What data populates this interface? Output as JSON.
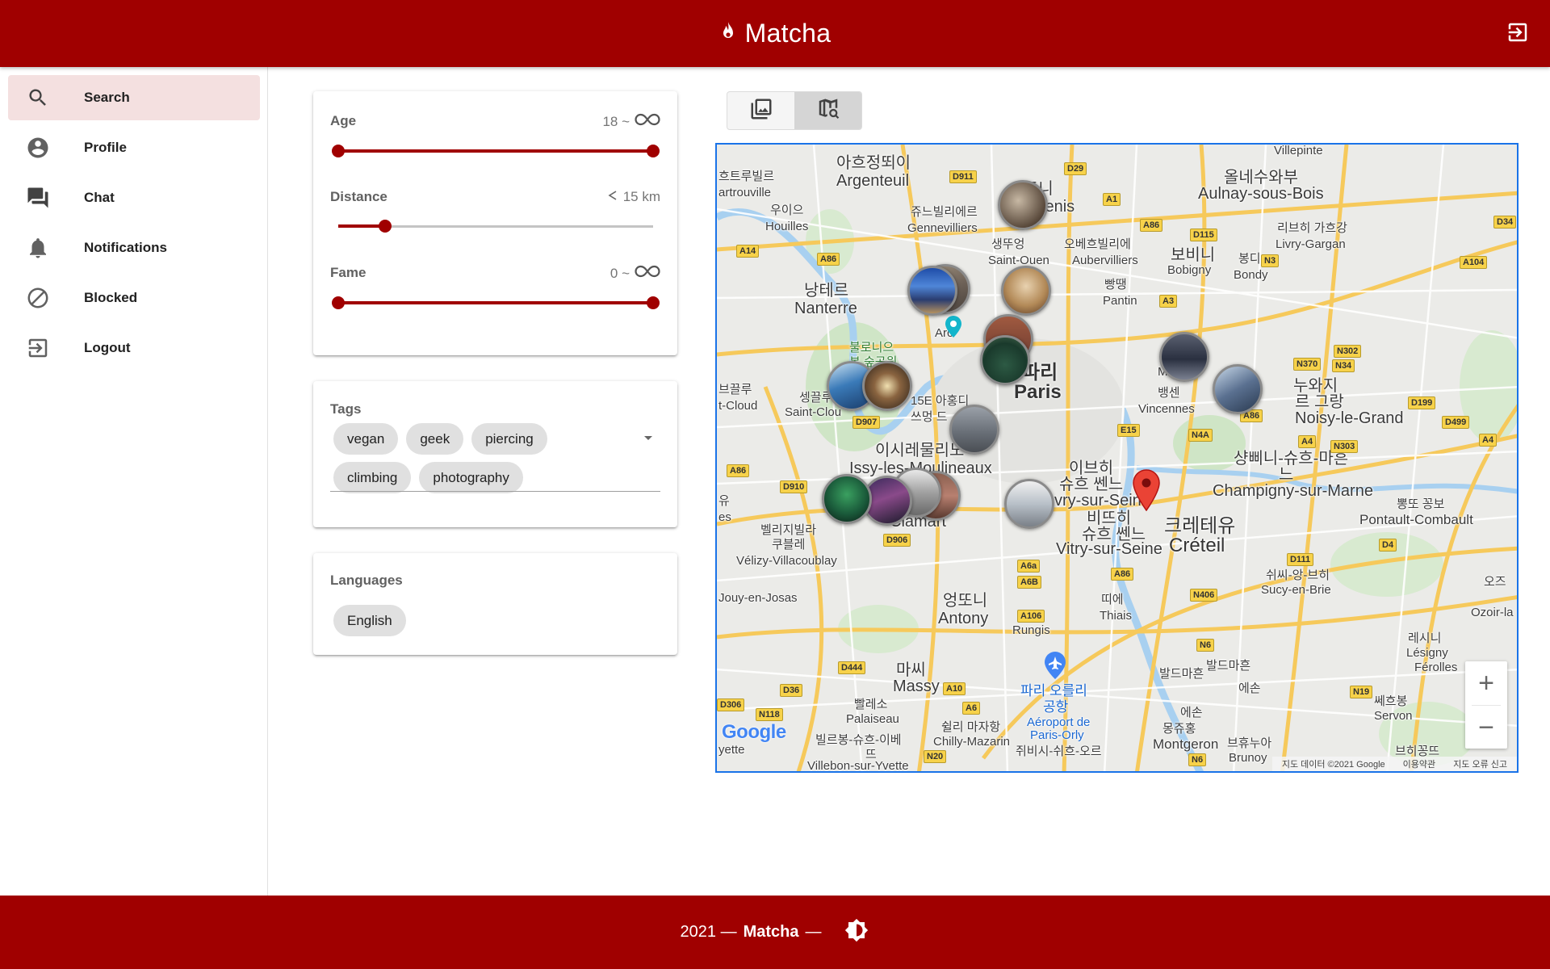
{
  "app": {
    "title": "Matcha",
    "brand_icon": "fire-icon",
    "logout_icon": "logout-icon"
  },
  "sidebar": {
    "items": [
      {
        "label": "Search",
        "icon": "search-icon",
        "active": true
      },
      {
        "label": "Profile",
        "icon": "account-circle-icon"
      },
      {
        "label": "Chat",
        "icon": "forum-icon"
      },
      {
        "label": "Notifications",
        "icon": "bell-icon"
      },
      {
        "label": "Blocked",
        "icon": "block-icon"
      },
      {
        "label": "Logout",
        "icon": "logout-icon"
      }
    ]
  },
  "filters": {
    "age": {
      "label": "Age",
      "value_prefix": "18 ~",
      "value_suffix_icon": "infinity-icon",
      "range": [
        0,
        1
      ]
    },
    "distance": {
      "label": "Distance",
      "value_prefix_icon": "less-than-icon",
      "value": "15 km",
      "level": 0.12
    },
    "fame": {
      "label": "Fame",
      "value_prefix": "0 ~",
      "value_suffix_icon": "infinity-icon",
      "range": [
        0,
        1
      ]
    }
  },
  "tags": {
    "label": "Tags",
    "items": [
      "vegan",
      "geek",
      "piercing",
      "climbing",
      "photography"
    ]
  },
  "languages": {
    "label": "Languages",
    "items": [
      "English"
    ]
  },
  "view_toggle": {
    "options": [
      "gallery-icon",
      "map-search-icon"
    ],
    "active": 1
  },
  "map": {
    "labels": {
      "argenteuil_ko": "아흐정뙤이",
      "argenteuil": "Argenteuil",
      "sartrouville_ko": "흐트루빌르",
      "sartrouville": "artrouville",
      "houilles_ko": "우이으",
      "houilles": "Houilles",
      "gennevilliers_ko": "쥬느빌리에르",
      "gennevilliers": "Gennevilliers",
      "saintdenis_ko": "드니",
      "saintdenis": "Denis",
      "saintouen_ko": "생뚜엉",
      "saintouen": "Saint-Ouen",
      "aubervilliers_ko": "오베흐빌리에",
      "aubervilliers": "Aubervilliers",
      "bobigny_ko": "보비니",
      "bobigny": "Bobigny",
      "bondy_ko": "봉디",
      "bondy": "Bondy",
      "pantin_ko": "빵땡",
      "pantin": "Pantin",
      "aulnay_ko": "올네수와부",
      "aulnay": "Aulnay-sous-Bois",
      "livry_ko": "리브히 가흐강",
      "livry": "Livry-Gargan",
      "villepinte": "Villepinte",
      "nanterre_ko": "낭테르",
      "nanterre": "Nanterre",
      "arc": "Arc",
      "paris_ko": "파리",
      "paris": "Paris",
      "boulogne_ko": "불로니으",
      "boulogne_ko2": "본 숲공원",
      "saintcloud_ko": "셍끌루",
      "saintcloud": "Saint-Clou",
      "bougival_ko": "브끌루",
      "bougival": "t-Cloud",
      "arr15_ko": "15E 아홍디",
      "arr15b_ko": "쓰멍 드 ",
      "arr15c": "15",
      "issy_ko": "이시레물리노",
      "issy": "Issy-les-Moulineaux",
      "montreuil": "Mo",
      "vincennes_ko": "뱅센",
      "vincennes": "Vincennes",
      "noisy_ko": "누와지",
      "noisy_ko2": "르 그랑",
      "noisy": "Noisy-le-Grand",
      "champigny_ko": "샹삐니-슈흐-마흔",
      "champigny_ko2": "느",
      "champigny": "Champigny-sur-Marne",
      "ivry_ko": "이브히",
      "ivry_ko2": "슈흐 쎈느",
      "ivry": "vry-sur-Seine",
      "vitry_ko": "비뜨히",
      "vitry_ko2": "슈흐 쎈느",
      "vitry": "Vitry-sur-Seine",
      "creteil_ko": "크레테유",
      "creteil": "Créteil",
      "pontault_ko": "뽕또 꽁보",
      "pontault": "Pontault-Combault",
      "clamart": "Clamart",
      "velizy_ko": "벨리지빌라",
      "velizy_ko2": "쿠블레",
      "velizy": "Vélizy-Villacoublay",
      "jouy": "Jouy-en-Josas",
      "antony_ko": "엉또니",
      "antony": "Antony",
      "thiais_ko": "띠에",
      "thiais": "Thiais",
      "rungis": "Rungis",
      "sucy_ko": "쉬씨-앙-브히",
      "sucy": "Sucy-en-Brie",
      "ozoir_ko": "오즈",
      "ozoir": "Ozoir-la",
      "lesigny_ko": "레시니",
      "lesigny": "Lésigny",
      "ferolles": "Férolles",
      "massy_ko": "마씨",
      "massy": "Massy",
      "palaiseau_ko": "빨레소",
      "palaiseau": "Palaiseau",
      "chilly_ko": "쉴리 마자항",
      "chilly": "Chilly-Mazarin",
      "orly_ko": "파리 오를리",
      "orly_ko2": "공항",
      "orly": "Aéroport de",
      "orly2": "Paris-Orly",
      "juvisy_ko": "쥐비시-쉬흐-오르",
      "villebon_ko": "빌르봉-슈흐-이베",
      "villebon_ko2": "뜨",
      "villebon": "Villebon-sur-Yvette",
      "montgeron_ko": "몽쥬홍",
      "montgeron": "Montgeron",
      "brunoy_ko": "브휴누아",
      "brunoy": "Brunoy",
      "servon_ko": "쎄흐봉",
      "servon": "Servon",
      "brie_ko": "브히꽁뜨",
      "yette": "yette",
      "es": "es",
      "yu": "유",
      "bd_ko": "발드마흔",
      "bd_ko2": "발드마흔",
      "essonne_ko": "에손",
      "essonne_ko2": "에손"
    },
    "roads": [
      "D911",
      "D29",
      "A1",
      "A86",
      "D115",
      "N3",
      "A104",
      "D34",
      "A14",
      "A86",
      "A3",
      "N370",
      "N302",
      "N34",
      "D199",
      "D499",
      "A4",
      "A86",
      "N303",
      "A4",
      "E15",
      "N4A",
      "D907",
      "D910",
      "A86",
      "D906",
      "A6a",
      "A6B",
      "A86",
      "D111",
      "D4",
      "N406",
      "N6",
      "A106",
      "D444",
      "D36",
      "A10",
      "D306",
      "N118",
      "A6",
      "N20",
      "N6",
      "N19"
    ],
    "zoom_in": "+",
    "zoom_out": "−",
    "google": "Google",
    "attribution": "지도 데이터 ©2021 Google",
    "terms": "이용약관",
    "report": "지도 오류 신고"
  },
  "footer": {
    "year": "2021 —",
    "brand": "Matcha",
    "dash": "—",
    "theme_icon": "brightness-icon"
  },
  "colors": {
    "primary": "#a00000",
    "active_bg": "#f4e0e0",
    "map_border": "#1a73e8"
  }
}
